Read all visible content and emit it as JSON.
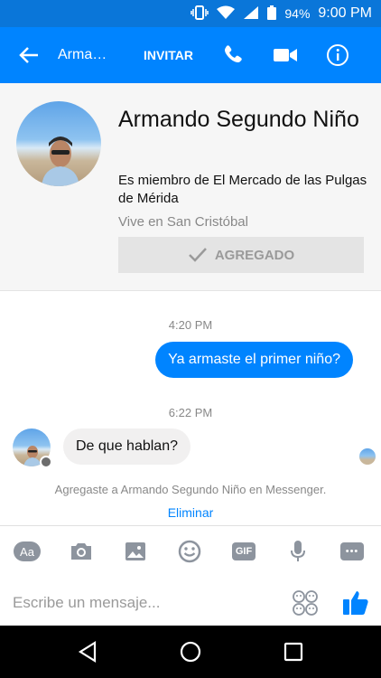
{
  "status_bar": {
    "battery": "94%",
    "time": "9:00 PM"
  },
  "header": {
    "title": "Arma…",
    "invite_label": "INVITAR"
  },
  "profile": {
    "name": "Armando Segundo Niño",
    "membership": "Es miembro de El Mercado de las Pulgas de Mérida",
    "lives_in": "Vive en San Cristóbal",
    "added_label": "AGREGADO"
  },
  "conversation": {
    "timestamp_1": "4:20 PM",
    "outgoing_message": "Ya armaste el primer niño?",
    "timestamp_2": "6:22 PM",
    "incoming_message": "De que hablan?",
    "added_notice": "Agregaste a Armando Segundo Niño en Messenger.",
    "remove_label": "Eliminar"
  },
  "composer": {
    "aa_label": "Aa",
    "gif_label": "GIF",
    "more_label": "•••",
    "placeholder": "Escribe un mensaje..."
  },
  "colors": {
    "brand": "#0084ff",
    "status_bar": "#0a76d9"
  }
}
